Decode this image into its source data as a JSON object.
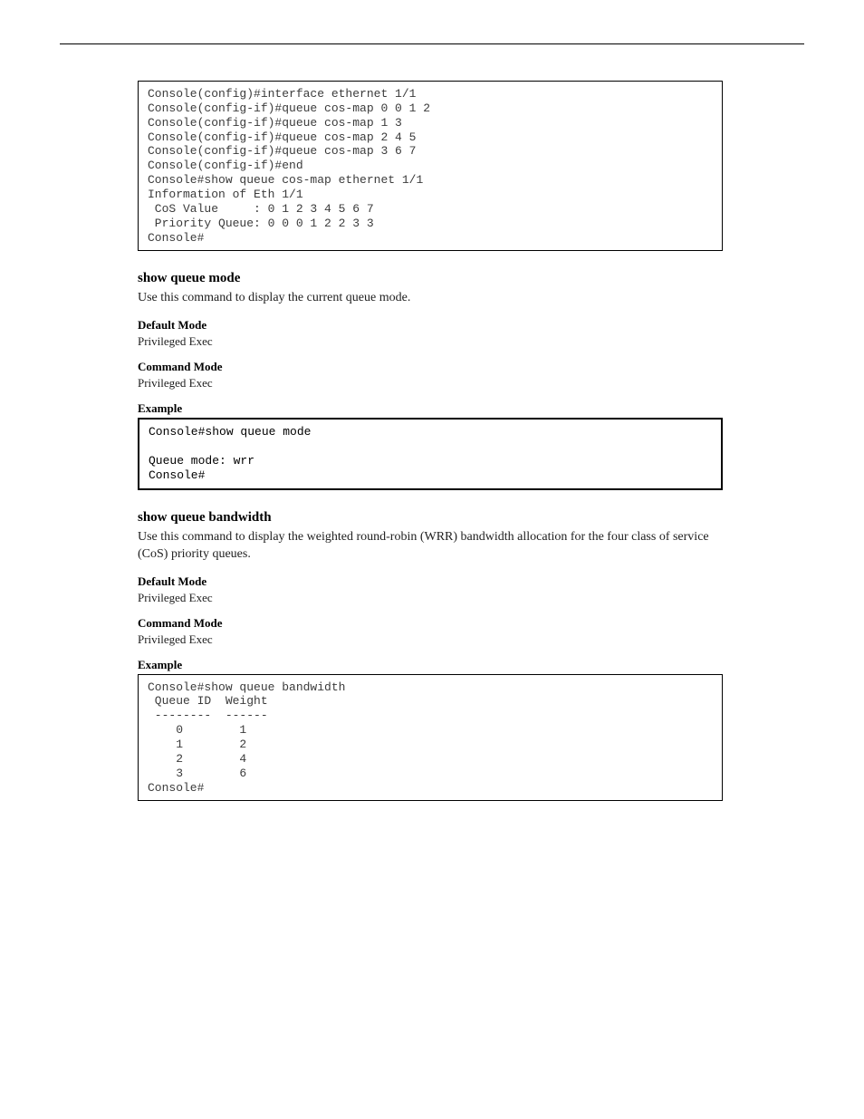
{
  "header": {
    "right_top": "",
    "right_bottom": ""
  },
  "code1": "Console(config)#interface ethernet 1/1\nConsole(config-if)#queue cos-map 0 0 1 2\nConsole(config-if)#queue cos-map 1 3\nConsole(config-if)#queue cos-map 2 4 5\nConsole(config-if)#queue cos-map 3 6 7\nConsole(config-if)#end\nConsole#show queue cos-map ethernet 1/1\nInformation of Eth 1/1\n CoS Value     : 0 1 2 3 4 5 6 7\n Priority Queue: 0 0 0 1 2 2 3 3\nConsole#",
  "sec1": {
    "title": "show queue mode",
    "desc": "Use this command to display the current queue mode."
  },
  "dm": {
    "label": "Default Mode",
    "value": "Privileged Exec"
  },
  "cm": {
    "label": "Command Mode",
    "value": "Privileged Exec"
  },
  "ex": {
    "label": "Example"
  },
  "code2": "Console#show queue mode\n\nQueue mode: wrr\nConsole#",
  "sec2": {
    "title": "show queue bandwidth",
    "desc": "Use this command to display the weighted round-robin (WRR) bandwidth allocation for the four class of service (CoS) priority queues."
  },
  "code3": "Console#show queue bandwidth\n Queue ID  Weight\n --------  ------\n    0        1\n    1        2\n    2        4\n    3        6\nConsole#",
  "footer": ""
}
